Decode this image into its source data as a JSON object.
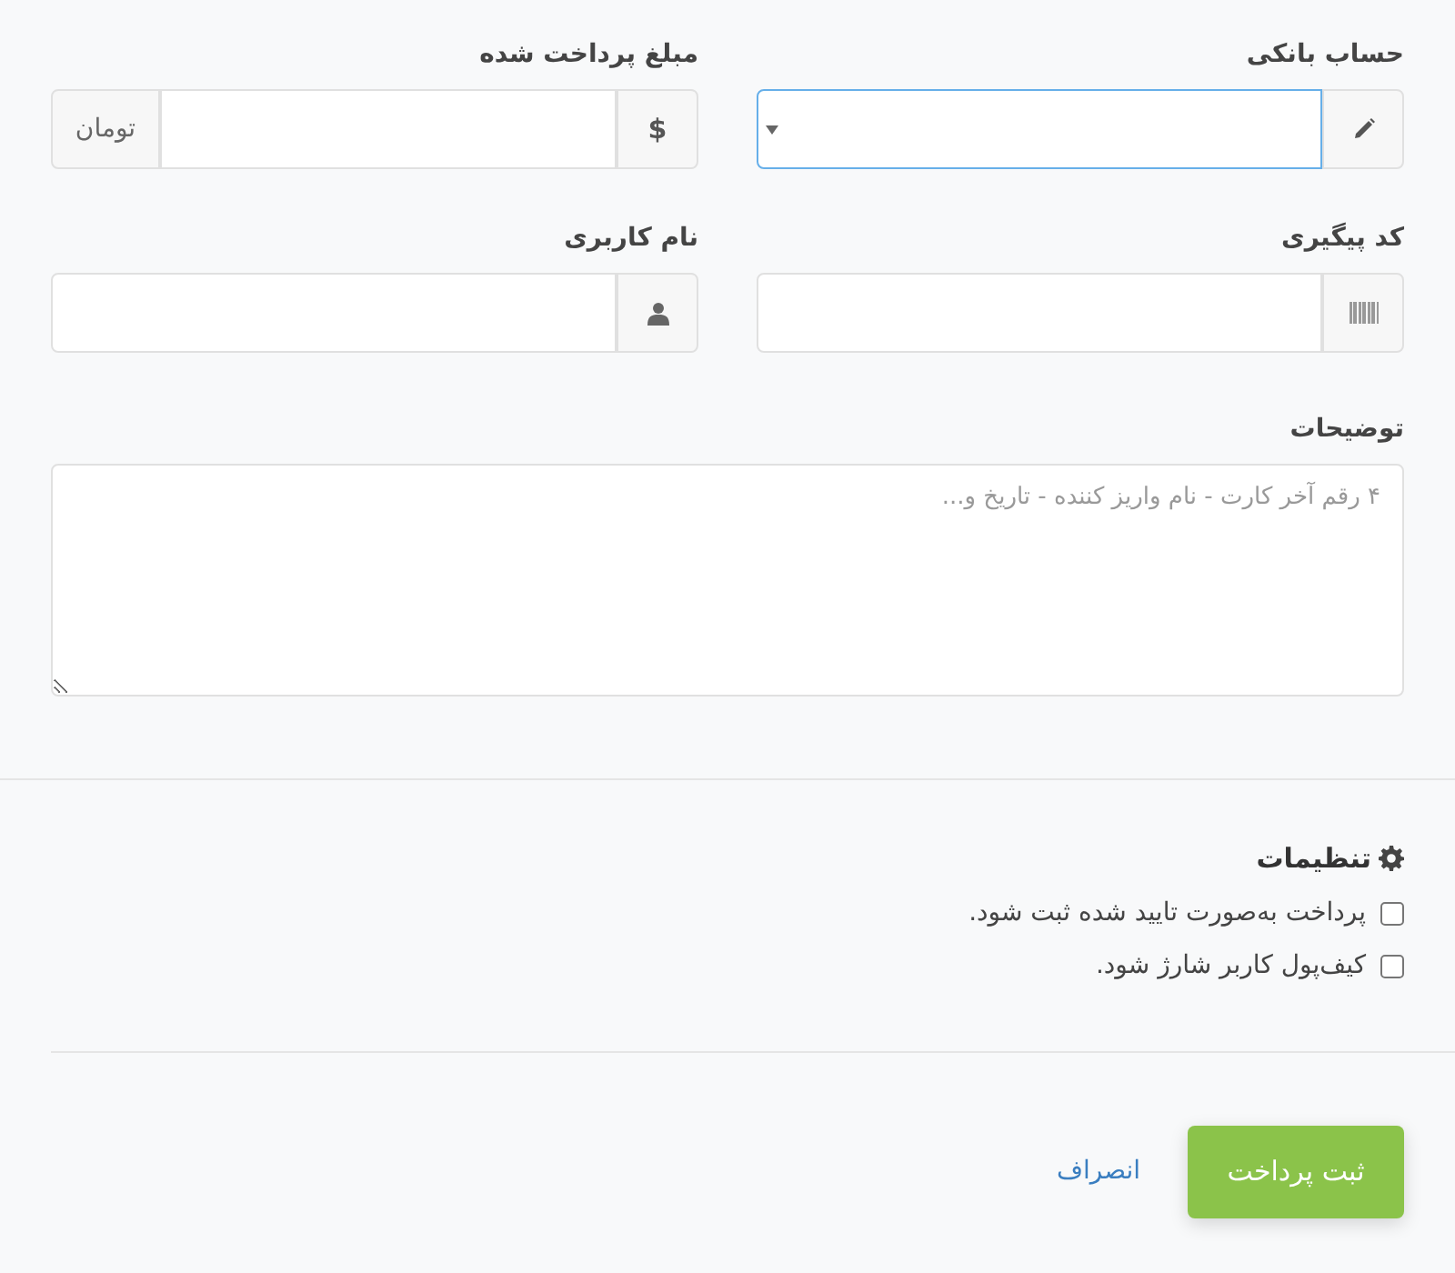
{
  "fields": [
    {
      "kind": "select",
      "label": "حساب بانکی",
      "focused": true
    },
    {
      "kind": "amount",
      "label": "مبلغ پرداخت شده",
      "prefix": "$",
      "suffix": "تومان",
      "focused": false
    },
    {
      "kind": "text",
      "label": "کد پیگیری",
      "focused": false
    },
    {
      "kind": "text",
      "label": "نام کاربری",
      "focused": false
    }
  ],
  "description": {
    "label": "توضیحات",
    "placeholder": "۴ رقم آخر کارت - نام واریز کننده - تاریخ و..."
  },
  "settings": {
    "title": "تنظیمات",
    "options": [
      {
        "label": "پرداخت به‌صورت تایید شده ثبت شود.",
        "checked": false
      },
      {
        "label": "کیف‌پول کاربر شارژ شود.",
        "checked": false
      }
    ]
  },
  "buttons": {
    "submit": "ثبت پرداخت",
    "cancel": "انصراف"
  }
}
